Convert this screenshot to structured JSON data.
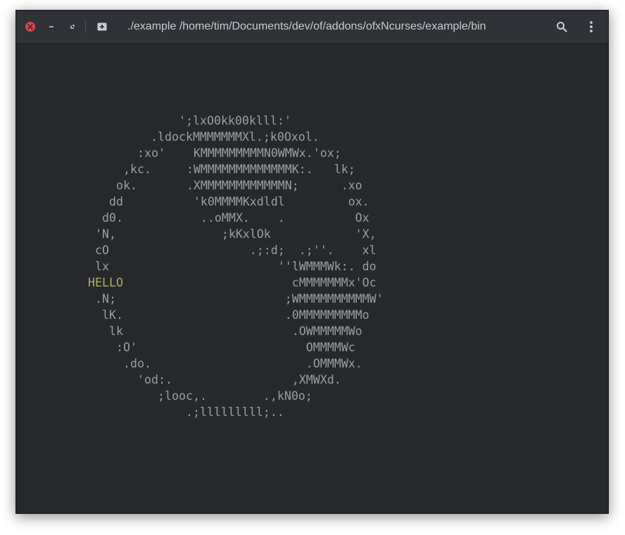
{
  "window": {
    "title": "./example /home/tim/Documents/dev/of/addons/ofxNcurses/example/bin"
  },
  "titlebar_icons": {
    "close": "close-icon",
    "minimize": "minimize-icon",
    "restore": "restore-icon",
    "new_tab": "new-tab-icon",
    "search": "search-icon",
    "menu": "kebab-menu-icon"
  },
  "colors": {
    "terminal_bg": "#26282c",
    "terminal_text": "#9a9ea5",
    "hello_text": "#b0b24f",
    "close_button": "#e1434b"
  },
  "terminal": {
    "hello_text": "HELLO",
    "lines": [
      "';lxO0kk00klll:'",
      ".ldockMMMMMMMXl.;k0Oxol.",
      ":xo'    KMMMMMMMMMN0WMWx.'ox;",
      ",kc.     :WMMMMMMMMMMMMMK:.   lk;",
      "ok.       .XMMMMMMMMMMMMN;      .xo",
      "dd          'k0MMMMKxdldl         ox.",
      "d0.           ..oMMX.    .          Ox",
      "'N,               ;kKxlOk            'X,",
      "cO                    .;:d;  .;''.    xl",
      "lx                        ''lWMMMWk:. do",
      "                           cMMMMMMMx'Oc",
      ".N;                        ;WMMMMMMMMMMW'",
      "lK.                       .0MMMMMMMMMo",
      "lk                        .OWMMMMMWo",
      ":O'                        OMMMMWc",
      ".do.                      .OMMMWx.",
      "'od:.                 ,XMWXd.",
      ";looc,.        .,kN0o;",
      ".;lllllllll;.."
    ]
  }
}
